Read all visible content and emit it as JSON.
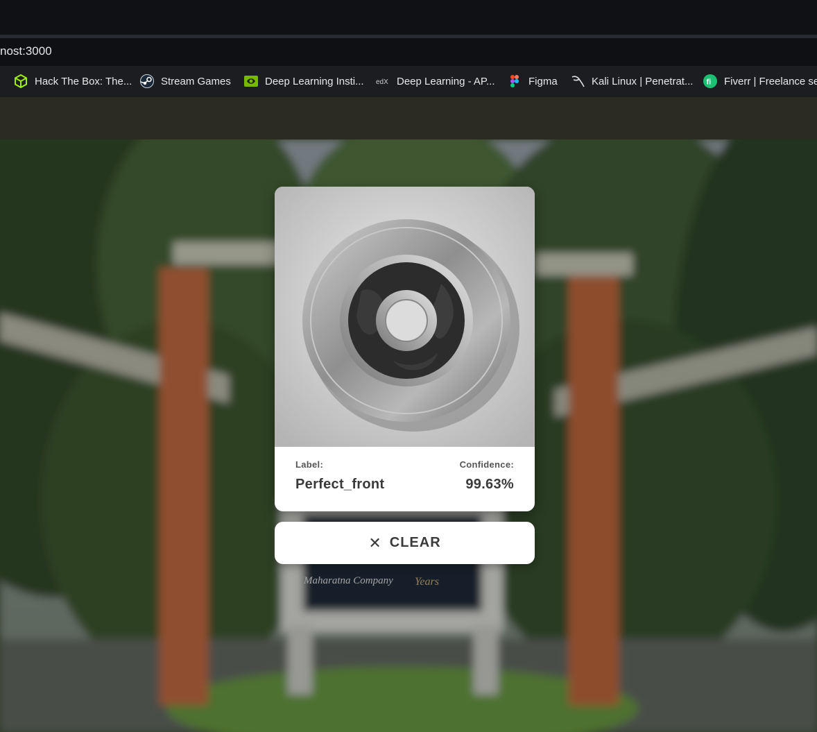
{
  "browser": {
    "url": "nost:3000",
    "bookmarks": [
      {
        "label": "Hack The Box: The...",
        "icon": "hackthebox-cube-icon",
        "color": "#9fef00"
      },
      {
        "label": "Stream Games",
        "icon": "steam-icon",
        "color": "#c7d5e0"
      },
      {
        "label": "Deep Learning Insti...",
        "icon": "nvidia-icon",
        "color": "#76b900"
      },
      {
        "label": "Deep Learning - AP...",
        "icon": "edx-icon",
        "color": "#cfcfcf"
      },
      {
        "label": "Figma",
        "icon": "figma-icon",
        "color": "#f24e1e"
      },
      {
        "label": "Kali Linux | Penetrat...",
        "icon": "kali-dragon-icon",
        "color": "#e0e0e0"
      },
      {
        "label": "Fiverr | Freelance se...",
        "icon": "fiverr-icon",
        "color": "#1dbf73"
      }
    ]
  },
  "result": {
    "label_caption": "Label:",
    "label_value": "Perfect_front",
    "confidence_caption": "Confidence:",
    "confidence_value": "99.63%"
  },
  "actions": {
    "clear_icon": "close-icon",
    "clear_label": "CLEAR"
  },
  "signboard": {
    "company": "Maharatna Company",
    "years": "Years"
  }
}
